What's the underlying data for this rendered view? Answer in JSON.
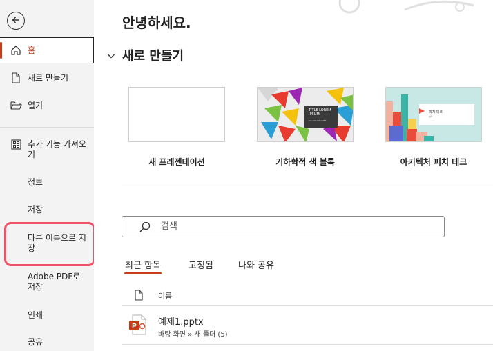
{
  "sidebar": {
    "items": [
      {
        "id": "home",
        "label": "홈",
        "icon": "home-icon"
      },
      {
        "id": "new",
        "label": "새로 만들기",
        "icon": "new-document-icon"
      },
      {
        "id": "open",
        "label": "열기",
        "icon": "folder-open-icon"
      },
      {
        "id": "addins",
        "label": "추가 기능 가져오기",
        "icon": "addins-grid-icon"
      },
      {
        "id": "info",
        "label": "정보"
      },
      {
        "id": "save",
        "label": "저장"
      },
      {
        "id": "saveas",
        "label": "다른 이름으로 저장"
      },
      {
        "id": "adobe",
        "label": "Adobe PDF로 저장"
      },
      {
        "id": "print",
        "label": "인쇄"
      },
      {
        "id": "share",
        "label": "공유"
      }
    ],
    "accent_color": "#c43e1c",
    "highlight_color": "#f05266"
  },
  "main": {
    "greeting": "안녕하세요.",
    "new_section_title": "새로 만들기",
    "templates": [
      {
        "name": "새 프레젠테이션"
      },
      {
        "name": "기하학적 색 블록",
        "thumb_title": "TITLE LOREM IPSUM",
        "thumb_sub": "SIT DOLOR AMET"
      },
      {
        "name": "아키텍처 피치 데크",
        "thumb_title": "피치 데크",
        "thumb_sub": "날짜"
      }
    ],
    "search": {
      "placeholder": "검색"
    },
    "tabs": [
      "최근 항목",
      "고정됨",
      "나와 공유"
    ],
    "list_header": {
      "name": "이름"
    },
    "files": [
      {
        "name": "예제1.pptx",
        "path": "바탕 화면 » 새 폴더 (5)"
      }
    ]
  }
}
